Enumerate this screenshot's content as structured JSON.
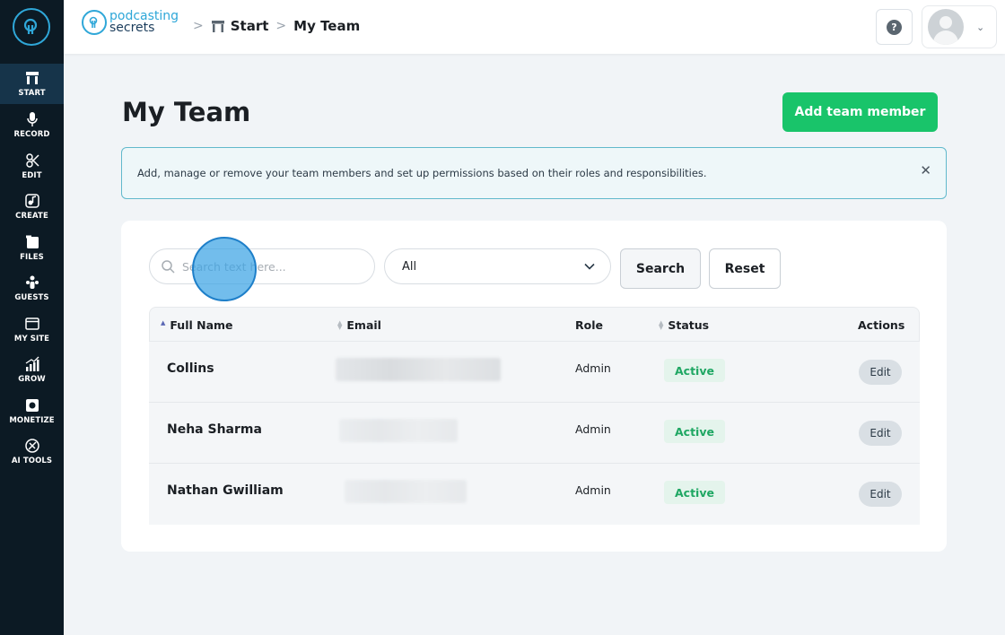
{
  "sidebar": {
    "items": [
      {
        "label": "START",
        "icon": "start-icon",
        "active": true
      },
      {
        "label": "RECORD",
        "icon": "microphone-icon"
      },
      {
        "label": "EDIT",
        "icon": "edit-icon"
      },
      {
        "label": "CREATE",
        "icon": "create-icon"
      },
      {
        "label": "FILES",
        "icon": "files-icon"
      },
      {
        "label": "GUESTS",
        "icon": "guests-icon"
      },
      {
        "label": "MY SITE",
        "icon": "site-icon"
      },
      {
        "label": "GROW",
        "icon": "grow-icon"
      },
      {
        "label": "MONETIZE",
        "icon": "monetize-icon"
      },
      {
        "label": "AI TOOLS",
        "icon": "ai-tools-icon"
      }
    ]
  },
  "header": {
    "brand_line1": "podcasting",
    "brand_line2": "secrets",
    "breadcrumb": [
      "Start",
      "My Team"
    ],
    "help_label": "?"
  },
  "page": {
    "title": "My Team",
    "add_button": "Add team member",
    "info_text": "Add, manage or remove your team members and set up permissions based on their roles and responsibilities.",
    "info_close": "✕"
  },
  "filters": {
    "search_placeholder": "Search text here...",
    "select_value": "All",
    "search_button": "Search",
    "reset_button": "Reset"
  },
  "table": {
    "columns": [
      "Full Name",
      "Email",
      "Role",
      "Status",
      "Actions"
    ],
    "rows": [
      {
        "name": "Collins",
        "role": "Admin",
        "status": "Active",
        "action": "Edit"
      },
      {
        "name": "Neha Sharma",
        "role": "Admin",
        "status": "Active",
        "action": "Edit"
      },
      {
        "name": "Nathan Gwilliam",
        "role": "Admin",
        "status": "Active",
        "action": "Edit"
      }
    ]
  },
  "colors": {
    "sidebar_bg": "#0c1a24",
    "accent_green": "#19c46a",
    "brand_blue": "#2fa7d8",
    "status_green": "#1fa763"
  }
}
